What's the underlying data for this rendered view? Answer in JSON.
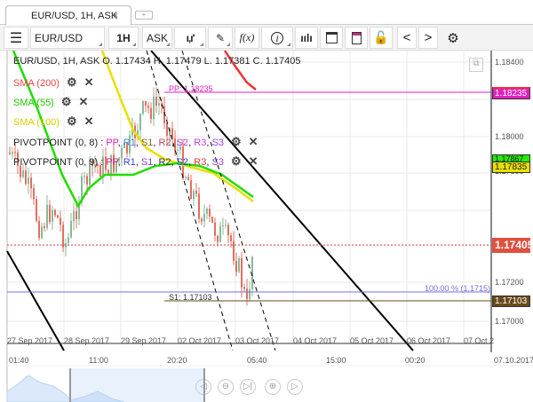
{
  "tab": {
    "title": "EUR/USD, 1H, ASK",
    "close": "×",
    "new_tab": "+"
  },
  "toolbar": {
    "menu": "☰",
    "instrument": "EUR/USD",
    "period": "1H",
    "side": "ASK",
    "fx": "f(x)",
    "info": "i",
    "prev": "<",
    "next": ">"
  },
  "legend": {
    "ohlc": "EUR/USD, 1H, ASK   O. 1.17434 H. 1.17479 L. 1.17381 C. 1.17405",
    "sma200": "SMA (200)",
    "sma55": "SMA (55)",
    "sma100": "SMA (100)",
    "pivot1": "PIVOTPOINT (0, 8)",
    "pivot2": "PIVOTPOINT (0, 9)",
    "pivot1_levels": [
      ": ",
      "PP",
      ", ",
      "R1",
      ", ",
      "S1",
      ", ",
      "R2",
      ", ",
      "S2",
      ", ",
      "R3",
      ", ",
      "S3"
    ],
    "pivot2_levels": [
      ": ",
      "PP",
      ", ",
      "R1",
      ", ",
      "S1",
      ", ",
      "R2",
      ", ",
      "S2",
      ", ",
      "R3",
      ", ",
      "S3"
    ]
  },
  "price_axis": [
    "1.18400",
    "1.18000",
    "1.17800",
    "1.17200",
    "1.17000"
  ],
  "price_tags": {
    "pp": "1.18235",
    "sma55": "1.17867",
    "sma100": "1.17835",
    "last": "1.17405",
    "s1": "1.17103"
  },
  "annotations": {
    "pp": "PP: 1.18235",
    "s1": "S1: 1.17103",
    "fib": "100.00 % (1.1715)"
  },
  "date_axis": [
    "27 Sep 2017",
    "28 Sep 2017",
    "29 Sep 2017",
    "02 Oct 2017",
    "03 Oct 2017",
    "04 Oct 2017",
    "05 Oct 2017",
    "06 Oct 2017",
    "07 Oct 2"
  ],
  "time_axis": [
    "01:40",
    "11:00",
    "20:20",
    "05:40",
    "15:00",
    "00:20",
    "07.10.2017"
  ],
  "colors": {
    "sma200": "#ee3333",
    "sma55": "#22dd00",
    "sma100": "#e8e000",
    "pp": "#e020c0",
    "up": "#8ab89a",
    "down": "#e07060",
    "last": "#e05040",
    "s1": "#6b4a1a"
  }
}
